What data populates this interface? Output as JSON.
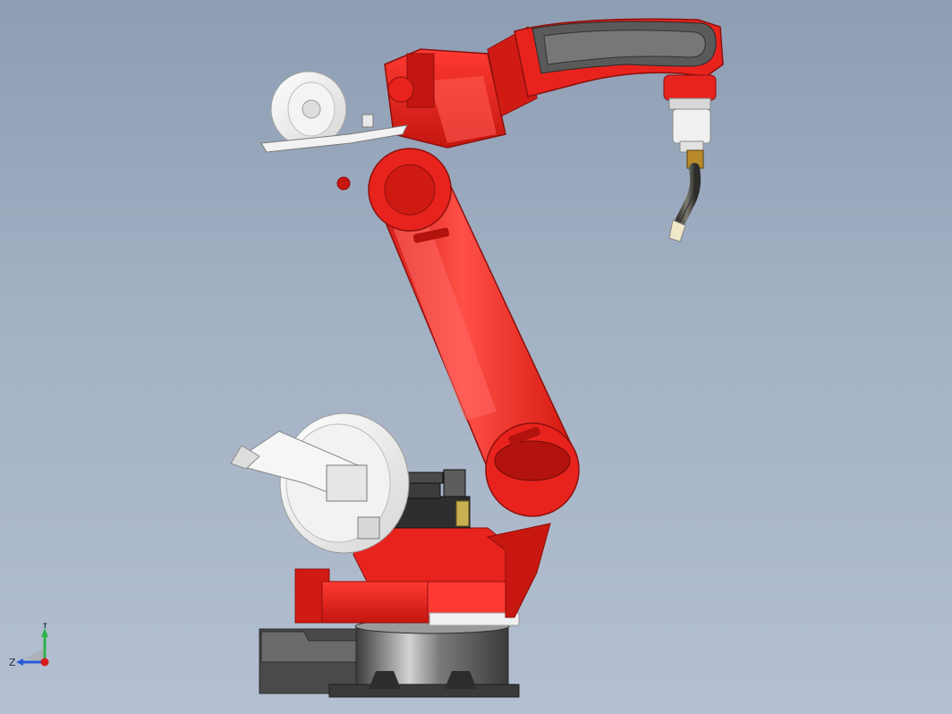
{
  "viewport": {
    "background_top": "#8d9db3",
    "background_bottom": "#b4c0d1"
  },
  "model": {
    "primary_color": "#e8231e",
    "highlight_color": "#ff6a64",
    "shadow_color": "#a8140f",
    "part_gray": "#5a5a5a",
    "part_white": "#f4f4f4"
  },
  "triad": {
    "y_label": "Y",
    "z_label": "Z",
    "y_color": "#2fb24a",
    "z_color": "#2a5ad8",
    "x_color": "#d61c1c"
  }
}
